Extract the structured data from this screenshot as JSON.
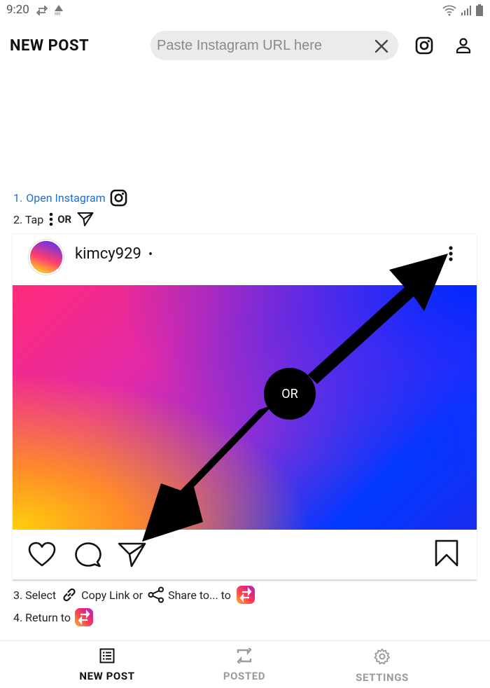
{
  "status_bar": {
    "time": "9:20",
    "left_icons": [
      "repost-icon",
      "mm-icon"
    ],
    "right_icons": [
      "wifi-icon",
      "signal-icon",
      "battery-icon"
    ]
  },
  "header": {
    "title": "NEW POST",
    "url_placeholder": "Paste Instagram URL here",
    "url_value": "",
    "icons": [
      "instagram-icon",
      "profile-icon"
    ]
  },
  "instructions": {
    "step1_prefix": "1.",
    "step1_link": "Open Instagram",
    "step2_text": "2. Tap",
    "step2_or": "OR",
    "step3_a": "3. Select",
    "step3_b": "Copy Link or",
    "step3_c": "Share to... to",
    "step4": "4. Return to"
  },
  "post": {
    "username": "kimcy929",
    "dot": "•",
    "or_label": "OR"
  },
  "bottom_nav": {
    "items": [
      {
        "label": "NEW POST",
        "icon": "list-icon",
        "active": true
      },
      {
        "label": "POSTED",
        "icon": "repost-icon",
        "active": false
      },
      {
        "label": "SETTINGS",
        "icon": "gear-icon",
        "active": false
      }
    ]
  },
  "colors": {
    "link": "#1e6fd0",
    "search_bg": "#ebebeb",
    "nav_inactive": "#9a9a9a"
  }
}
